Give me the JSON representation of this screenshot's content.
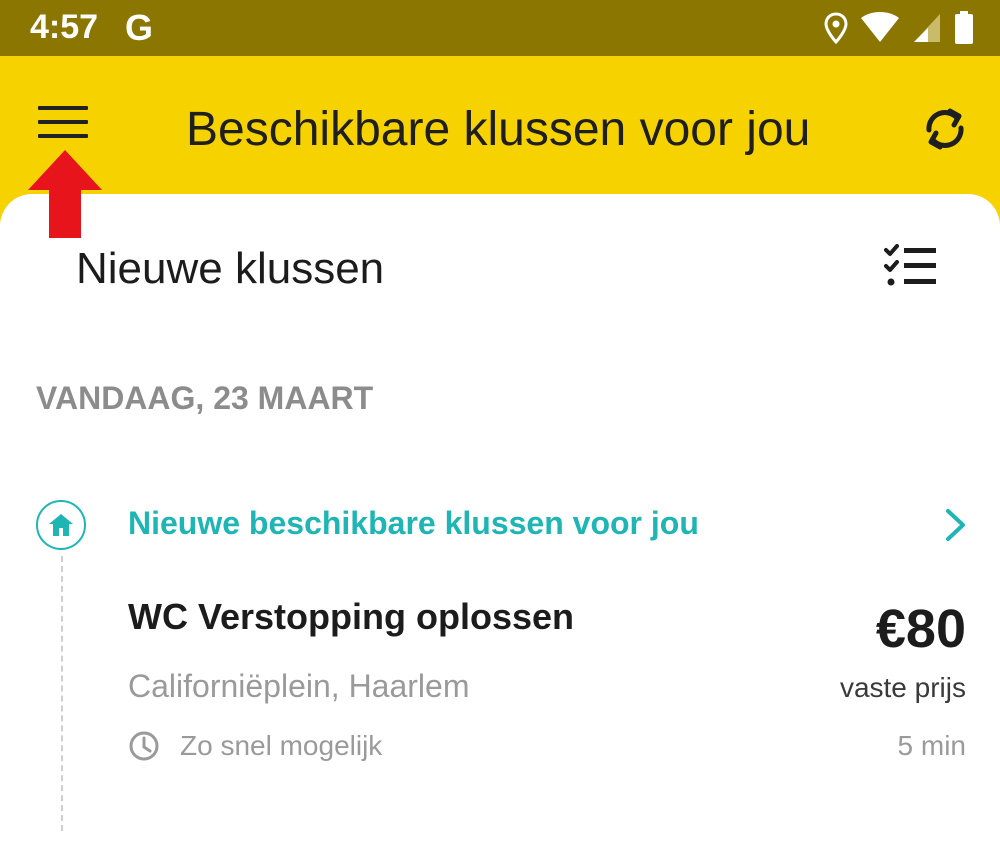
{
  "status_bar": {
    "time": "4:57",
    "google_letter": "G",
    "icons": [
      "location-icon",
      "wifi-icon",
      "signal-icon",
      "battery-icon"
    ]
  },
  "app_bar": {
    "title": "Beschikbare klussen voor jou",
    "menu_icon": "hamburger-menu-icon",
    "refresh_icon": "refresh-icon",
    "background_color": "#f6d200"
  },
  "annotation": {
    "arrow_color": "#e8141c"
  },
  "main": {
    "title": "Nieuwe klussen",
    "filter_icon": "checklist-filter-icon",
    "date_header": "VANDAAG, 23 MAART",
    "notification": {
      "icon": "home-icon",
      "label": "Nieuwe beschikbare klussen voor jou",
      "accent_color": "#1fb5b5"
    },
    "job": {
      "title": "WC Verstopping oplossen",
      "price": "€80",
      "price_type": "vaste prijs",
      "location": "Californiëplein, Haarlem",
      "when": "Zo snel mogelijk",
      "distance": "5 min"
    }
  }
}
